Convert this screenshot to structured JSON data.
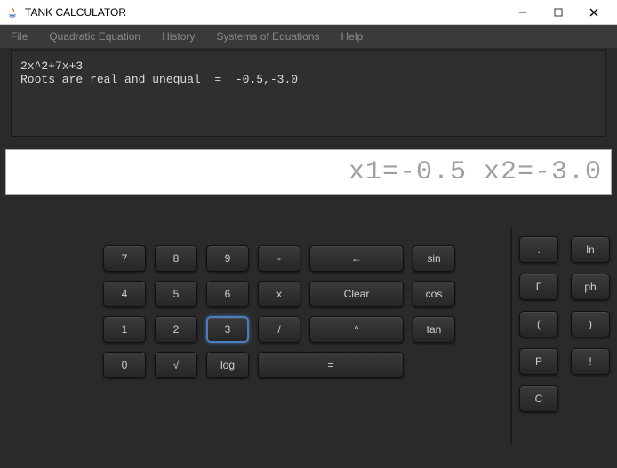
{
  "window": {
    "title": "TANK CALCULATOR"
  },
  "menu": {
    "file": "File",
    "quadratic": "Quadratic Equation",
    "history": "History",
    "systems": "Systems of Equations",
    "help": "Help"
  },
  "console": {
    "line1": "2x^2+7x+3",
    "line2": "Roots are real and unequal  =  -0.5,-3.0"
  },
  "display": {
    "value": "x1=-0.5 x2=-3.0"
  },
  "keys": {
    "k7": "7",
    "k8": "8",
    "k9": "9",
    "minus": "-",
    "back": "←",
    "sin": "sin",
    "k4": "4",
    "k5": "5",
    "k6": "6",
    "mult": "x",
    "clear": "Clear",
    "cos": "cos",
    "k1": "1",
    "k2": "2",
    "k3": "3",
    "div": "/",
    "pow": "^",
    "tan": "tan",
    "k0": "0",
    "sqrt": "√",
    "log": "log",
    "equals": "="
  },
  "sidekeys": {
    "dot": ".",
    "ln": "ln",
    "gamma": "Γ",
    "ph": "ph",
    "lparen": "(",
    "rparen": ")",
    "p": "P",
    "fact": "!",
    "c": "C"
  }
}
